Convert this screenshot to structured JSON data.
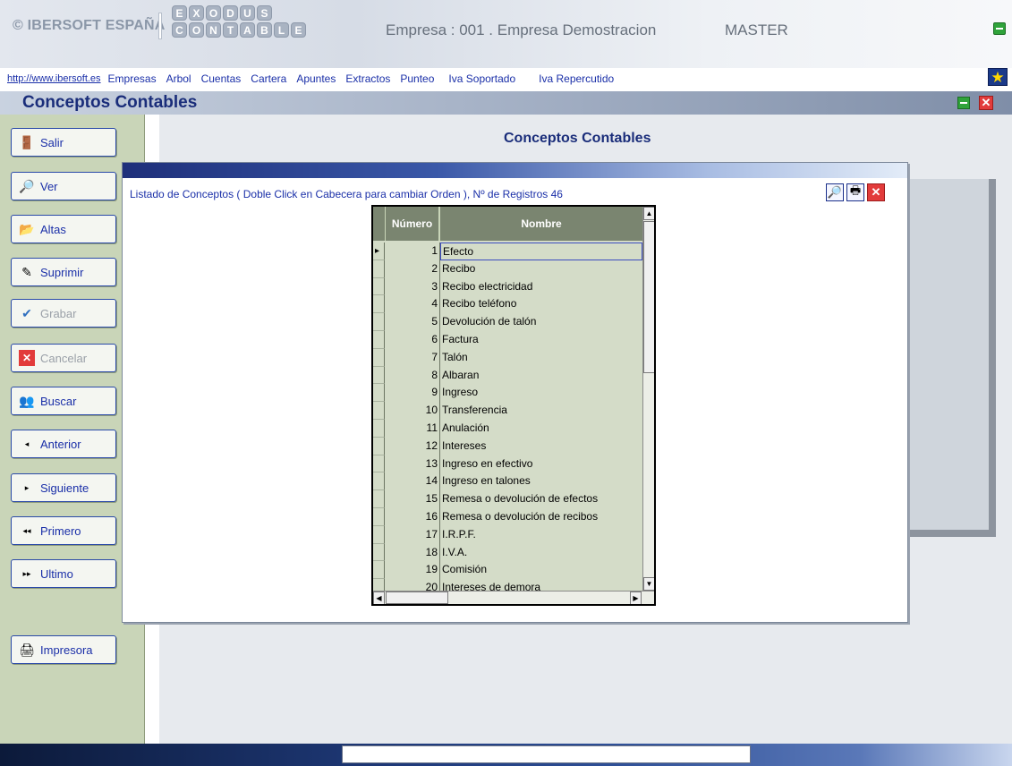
{
  "header": {
    "brand": "© IBERSOFT ESPAÑA",
    "logo_top": [
      "E",
      "X",
      "O",
      "D",
      "U",
      "S"
    ],
    "logo_bottom": [
      "C",
      "O",
      "N",
      "T",
      "A",
      "B",
      "L",
      "E"
    ],
    "empresa": "Empresa : 001 . Empresa Demostracion",
    "user": "MASTER"
  },
  "menu": {
    "site": "http://www.ibersoft.es",
    "items": [
      "Empresas",
      "Arbol",
      "Cuentas",
      "Cartera",
      "Apuntes",
      "Extractos",
      "Punteo",
      "Iva Soportado",
      "Iva Repercutido"
    ]
  },
  "form": {
    "title": "Conceptos Contables",
    "content_title": "Conceptos Contables"
  },
  "sidebar": {
    "salir": "Salir",
    "ver": "Ver",
    "altas": "Altas",
    "suprimir": "Suprimir",
    "grabar": "Grabar",
    "cancelar": "Cancelar",
    "buscar": "Buscar",
    "anterior": "Anterior",
    "siguiente": "Siguiente",
    "primero": "Primero",
    "ultimo": "Ultimo",
    "impresora": "Impresora"
  },
  "listing": {
    "caption": "Listado de Conceptos  ( Doble Click en Cabecera para cambiar Orden ),   Nº de Registros    46",
    "columns": {
      "num": "Número",
      "name": "Nombre"
    },
    "rows": [
      {
        "num": "1",
        "name": "Efecto"
      },
      {
        "num": "2",
        "name": "Recibo"
      },
      {
        "num": "3",
        "name": "Recibo electricidad"
      },
      {
        "num": "4",
        "name": "Recibo teléfono"
      },
      {
        "num": "5",
        "name": "Devolución de talón"
      },
      {
        "num": "6",
        "name": "Factura"
      },
      {
        "num": "7",
        "name": "Talón"
      },
      {
        "num": "8",
        "name": "Albaran"
      },
      {
        "num": "9",
        "name": "Ingreso"
      },
      {
        "num": "10",
        "name": "Transferencia"
      },
      {
        "num": "11",
        "name": "Anulación"
      },
      {
        "num": "12",
        "name": "Intereses"
      },
      {
        "num": "13",
        "name": "Ingreso en efectivo"
      },
      {
        "num": "14",
        "name": "Ingreso en talones"
      },
      {
        "num": "15",
        "name": "Remesa o devolución de efectos"
      },
      {
        "num": "16",
        "name": "Remesa o devolución de recibos"
      },
      {
        "num": "17",
        "name": "I.R.P.F."
      },
      {
        "num": "18",
        "name": "I.V.A."
      },
      {
        "num": "19",
        "name": "Comisión"
      },
      {
        "num": "20",
        "name": "Intereses de demora"
      }
    ]
  }
}
